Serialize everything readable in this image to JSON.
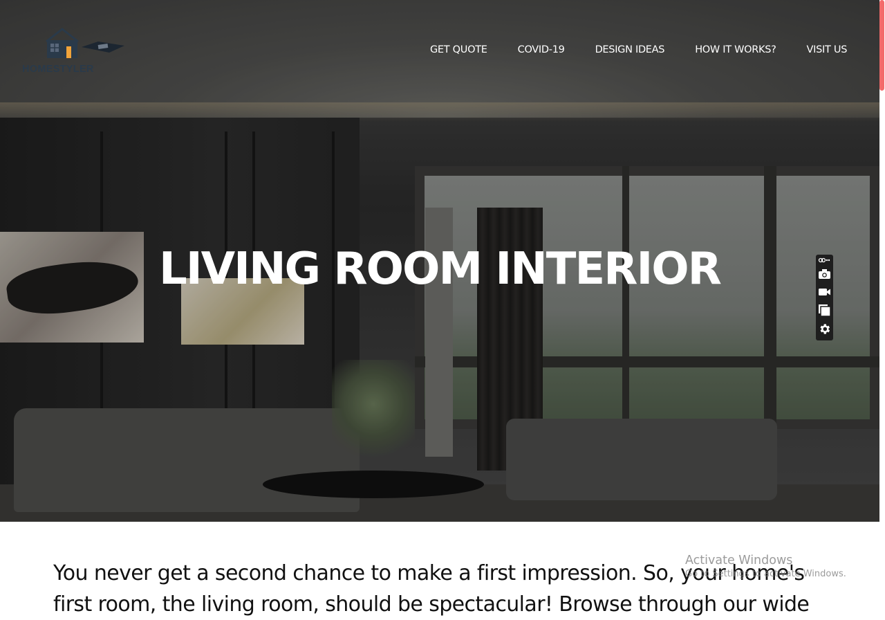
{
  "brand": {
    "name": "HOMESTYLER"
  },
  "nav": {
    "items": [
      {
        "label": "GET QUOTE"
      },
      {
        "label": "COVID-19"
      },
      {
        "label": "DESIGN IDEAS"
      },
      {
        "label": "HOW IT WORKS?"
      },
      {
        "label": "VISIT US"
      }
    ]
  },
  "hero": {
    "title": "LIVING ROOM INTERIOR"
  },
  "toolbar": {
    "icons": [
      "link-icon",
      "camera-icon",
      "video-icon",
      "copy-icon",
      "gear-icon"
    ]
  },
  "intro": {
    "text": "You never get a second chance to make a first impression. So, your home's first room, the living room, should be spectacular! Browse through our wide"
  },
  "watermark": {
    "title": "Activate Windows",
    "subtitle": "Go to Settings to activate Windows."
  },
  "colors": {
    "accent": "#f36b6b",
    "logo_window": "#f0a33a",
    "logo_dark": "#2a3a4a"
  }
}
